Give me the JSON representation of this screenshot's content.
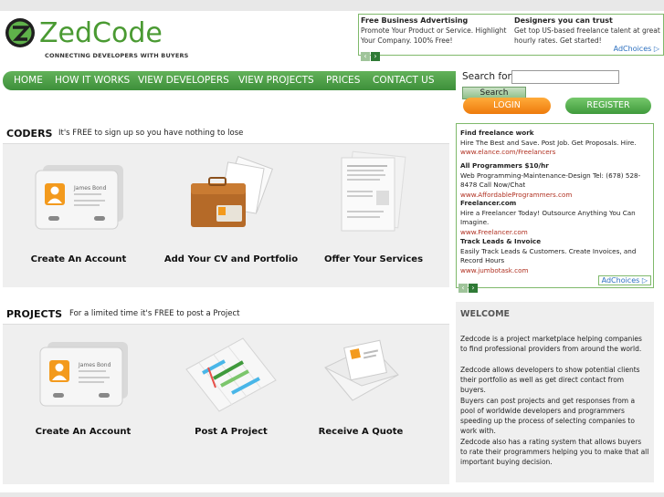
{
  "brand": {
    "name": "ZedCode",
    "tagline": "CONNECTING DEVELOPERS WITH BUYERS",
    "colors": {
      "green": "#4a9a32",
      "orange": "#ee7b0c",
      "link_red": "#b03020"
    }
  },
  "top_ads": [
    {
      "title": "Free Business Advertising",
      "text": "Promote Your Product or Service. Highlight Your Company. 100% Free!"
    },
    {
      "title": "Designers you can trust",
      "text": "Get top US-based freelance talent at great hourly rates. Get started!"
    }
  ],
  "adchoices": "AdChoices",
  "nav": {
    "items": [
      "HOME",
      "HOW IT WORKS",
      "VIEW DEVELOPERS",
      "VIEW PROJECTS",
      "PRICES",
      "CONTACT US"
    ]
  },
  "search": {
    "label": "Search for:",
    "value": "",
    "button": "Search"
  },
  "auth": {
    "login": "LOGIN",
    "register": "REGISTER"
  },
  "coders": {
    "title": "CODERS",
    "subtitle": "It's FREE to sign up so you have nothing to lose",
    "items": [
      {
        "label": "Create An Account",
        "icon": "user-card-icon"
      },
      {
        "label": "Add Your CV and Portfolio",
        "icon": "portfolio-folder-icon"
      },
      {
        "label": "Offer Your Services",
        "icon": "documents-icon"
      }
    ]
  },
  "projects": {
    "title": "PROJECTS",
    "subtitle": "For a limited time it's FREE to post a Project",
    "items": [
      {
        "label": "Create An Account",
        "icon": "user-card-icon"
      },
      {
        "label": "Post A Project",
        "icon": "gantt-chart-icon"
      },
      {
        "label": "Receive A Quote",
        "icon": "envelope-icon"
      }
    ]
  },
  "card": {
    "name": "James Bond"
  },
  "side_ads": [
    {
      "title": "Find freelance work",
      "text": "Hire The Best and Save. Post Job. Get Proposals. Hire.",
      "url": "www.elance.com/Freelancers"
    },
    {
      "title": "All Programmers $10/hr",
      "text": "Web Programming-Maintenance-Design Tel: (678) 528-8478 Call Now/Chat",
      "url": "www.AffordableProgrammers.com"
    },
    {
      "title": "Freelancer.com",
      "text": "Hire a Freelancer Today! Outsource Anything You Can Imagine.",
      "url": "www.Freelancer.com"
    },
    {
      "title": "Track Leads & Invoice",
      "text": "Easily Track Leads & Customers. Create Invoices, and Record Hours",
      "url": "www.jumbotask.com"
    }
  ],
  "welcome": {
    "title": "WELCOME",
    "paragraphs": [
      "Zedcode is a project marketplace helping companies to find professional providers from around the world.",
      "Zedcode allows developers to show potential clients their portfolio as well as get direct contact from buyers.",
      "Buyers can post projects and get responses from a pool of worldwide developers and programmers speeding up the process of selecting companies to work with.",
      "Zedcode also has a rating system that allows buyers to rate their programmers helping you to make that all important buying decision."
    ]
  }
}
